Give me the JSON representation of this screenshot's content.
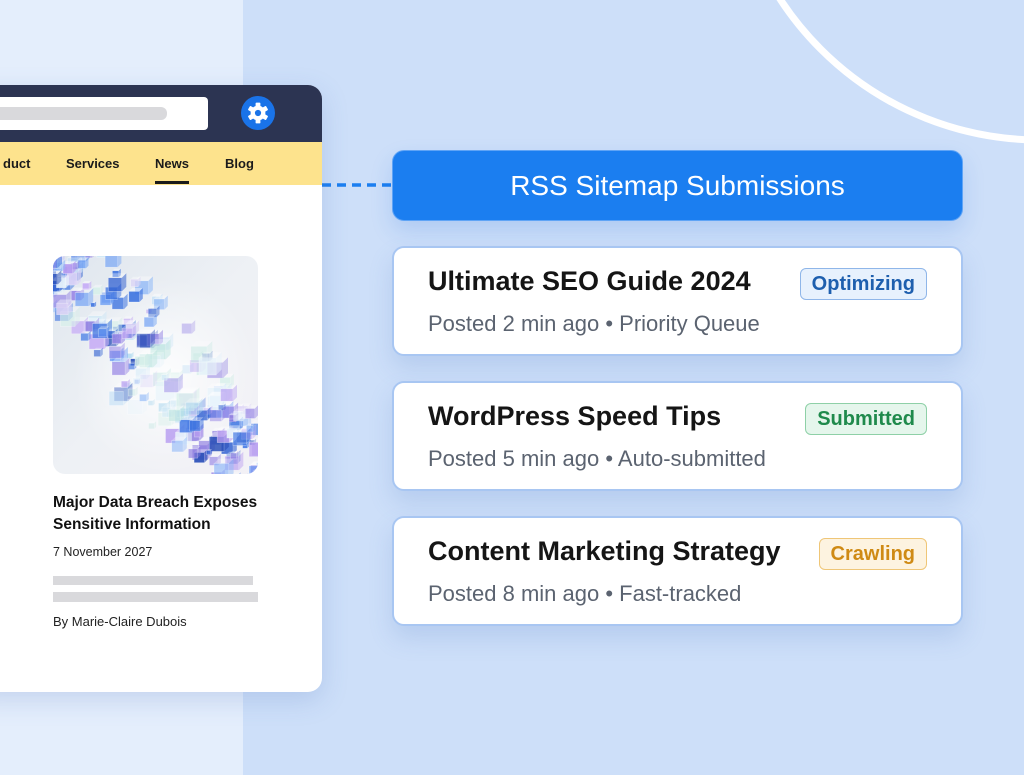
{
  "colors": {
    "accent": "#1b7ef0",
    "page_bg": "#e4eefc",
    "panel_bg": "#cddff9",
    "header_bar": "#2c3452",
    "nav_bar": "#fde38d",
    "card_border": "#a8c6f2",
    "settings_icon": "#1a73e8"
  },
  "icons": {
    "settings": "gear-icon"
  },
  "browser": {
    "nav": [
      {
        "label": "duct",
        "active": false
      },
      {
        "label": "Services",
        "active": false
      },
      {
        "label": "News",
        "active": true
      },
      {
        "label": "Blog",
        "active": false
      }
    ],
    "article": {
      "headline": "Major Data Breach Exposes Sensitive Information",
      "date": "7 November 2027",
      "author": "By Marie-Claire Dubois"
    }
  },
  "panel": {
    "title": "RSS Sitemap Submissions",
    "submissions": [
      {
        "title": "Ultimate SEO Guide 2024",
        "meta": "Posted 2 min ago • Priority Queue",
        "status": "Optimizing",
        "status_text_color": "#1e5fae",
        "status_bg": "#e7f1fd",
        "status_border": "#8fb6e9"
      },
      {
        "title": "WordPress Speed Tips",
        "meta": "Posted 5 min ago • Auto-submitted",
        "status": "Submitted",
        "status_text_color": "#1f8a4c",
        "status_bg": "#e5f6ec",
        "status_border": "#8ed0a7"
      },
      {
        "title": "Content Marketing Strategy",
        "meta": "Posted 8 min ago • Fast-tracked",
        "status": "Crawling",
        "status_text_color": "#cf8a14",
        "status_bg": "#fdf3e0",
        "status_border": "#efc677"
      }
    ]
  }
}
